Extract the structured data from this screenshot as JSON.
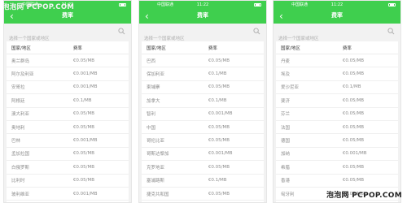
{
  "watermark": "泡泡网 PCPOP.COM",
  "phones": [
    {
      "status": {
        "carrier": "中国联通",
        "time": "11:22"
      },
      "nav": {
        "title": "费率"
      },
      "search": {
        "placeholder": "选择一个国家或地区"
      },
      "table": {
        "headers": [
          "国家/地区",
          "费率"
        ],
        "rows": [
          [
            "奥兰群岛",
            "€0.05/MB"
          ],
          [
            "阿尔及利亚",
            "€0.001/MB"
          ],
          [
            "安哥拉",
            "€0.001/MB"
          ],
          [
            "阿根廷",
            "€0.1/MB"
          ],
          [
            "澳大利亚",
            "€0.05/MB"
          ],
          [
            "奥地利",
            "€0.05/MB"
          ],
          [
            "巴林",
            "€0.001/MB"
          ],
          [
            "孟加拉国",
            "€0.05/MB"
          ],
          [
            "白俄罗斯",
            "€0.05/MB"
          ],
          [
            "比利时",
            "€0.05/MB"
          ],
          [
            "玻利维亚",
            "€0.001/MB"
          ]
        ]
      }
    },
    {
      "status": {
        "carrier": "中国联通",
        "time": "11:22"
      },
      "nav": {
        "title": "费率"
      },
      "search": {
        "placeholder": "选择一个国家或地区"
      },
      "table": {
        "headers": [
          "国家/地区",
          "费率"
        ],
        "rows": [
          [
            "巴西",
            "€0.05/MB"
          ],
          [
            "保加利亚",
            "€0.1/MB"
          ],
          [
            "柬埔寨",
            "€0.05/MB"
          ],
          [
            "加拿大",
            "€0.1/MB"
          ],
          [
            "智利",
            "€0.001/MB"
          ],
          [
            "中国",
            "€0.05/MB"
          ],
          [
            "哥伦比亚",
            "€0.05/MB"
          ],
          [
            "哥斯达黎加",
            "€0.001/MB"
          ],
          [
            "克罗地亚",
            "€0.05/MB"
          ],
          [
            "塞浦路斯",
            "€0.1/MB"
          ],
          [
            "捷克共和国",
            "€0.05/MB"
          ]
        ]
      }
    },
    {
      "status": {
        "carrier": "中国联通",
        "time": "11:22"
      },
      "nav": {
        "title": "费率"
      },
      "search": {
        "placeholder": "选择一个国家或地区"
      },
      "table": {
        "headers": [
          "国家/地区",
          "费率"
        ],
        "rows": [
          [
            "丹麦",
            "€0.05/MB"
          ],
          [
            "埃及",
            "€0.05/MB"
          ],
          [
            "爱沙尼亚",
            "€0.1/MB"
          ],
          [
            "斐济",
            "€0.05/MB"
          ],
          [
            "芬兰",
            "€0.05/MB"
          ],
          [
            "法国",
            "€0.05/MB"
          ],
          [
            "德国",
            "€0.05/MB"
          ],
          [
            "加纳",
            "€0.001/MB"
          ],
          [
            "希腊",
            "€0.05/MB"
          ],
          [
            "香港",
            "€0.05/MB"
          ],
          [
            "匈牙利",
            "€0.05/MB"
          ]
        ]
      }
    }
  ]
}
